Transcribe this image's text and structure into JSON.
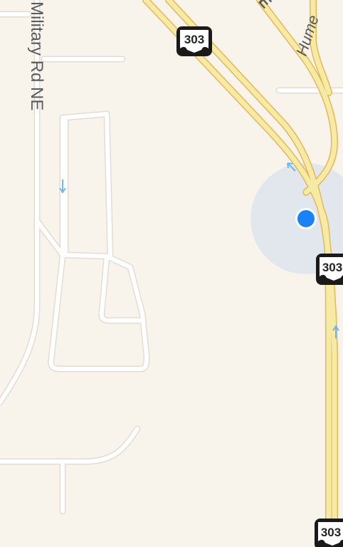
{
  "map": {
    "background_color": "#f8f4ec",
    "road_labels": {
      "military_rd": "Military Rd NE",
      "hume": "Hume",
      "top_partial": "E"
    },
    "route_shields": [
      {
        "route": "303"
      },
      {
        "route": "303"
      },
      {
        "route": "303"
      }
    ],
    "location_marker": {
      "color": "#1a82f7",
      "accuracy_circle_color": "#dfe6ee"
    },
    "colors": {
      "highway_fill": "#f7eaa4",
      "highway_edge": "#e3b85a",
      "local_road": "#ffffff",
      "local_road_edge": "#e2ddd4",
      "oneway_arrow": "#6fb8e6"
    }
  }
}
